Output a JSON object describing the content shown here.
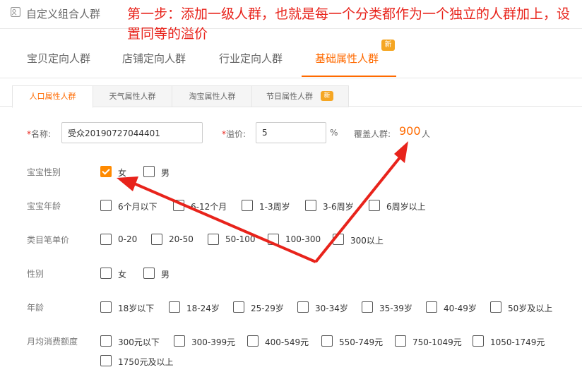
{
  "header": {
    "title": "自定义组合人群",
    "icon": "audience-edit-icon"
  },
  "annotation": "第一步：添加一级人群，也就是每一个分类都作为一个独立的人群加上，设置同等的溢价",
  "main_tabs": [
    {
      "label": "宝贝定向人群"
    },
    {
      "label": "店铺定向人群"
    },
    {
      "label": "行业定向人群"
    },
    {
      "label": "基础属性人群",
      "badge": "新"
    }
  ],
  "sub_tabs": [
    {
      "label": "人口属性人群"
    },
    {
      "label": "天气属性人群"
    },
    {
      "label": "淘宝属性人群"
    },
    {
      "label": "节日属性人群",
      "badge": "新"
    }
  ],
  "form": {
    "required_mark": "*",
    "name_label": "名称:",
    "name_value": "受众20190727044401",
    "premium_label": "溢价:",
    "premium_value": "5",
    "premium_unit": "%",
    "cover_label": "覆盖人群:",
    "cover_value": "900",
    "cover_unit": "人"
  },
  "rows": [
    {
      "label": "宝宝性别",
      "options": [
        {
          "text": "女",
          "checked": true
        },
        {
          "text": "男",
          "checked": false
        }
      ]
    },
    {
      "label": "宝宝年龄",
      "options": [
        {
          "text": "6个月以下"
        },
        {
          "text": "6-12个月"
        },
        {
          "text": "1-3周岁"
        },
        {
          "text": "3-6周岁"
        },
        {
          "text": "6周岁以上"
        }
      ]
    },
    {
      "label": "类目笔单价",
      "options": [
        {
          "text": "0-20"
        },
        {
          "text": "20-50"
        },
        {
          "text": "50-100"
        },
        {
          "text": "100-300"
        },
        {
          "text": "300以上"
        }
      ]
    },
    {
      "label": "性别",
      "options": [
        {
          "text": "女"
        },
        {
          "text": "男"
        }
      ]
    },
    {
      "label": "年龄",
      "options": [
        {
          "text": "18岁以下"
        },
        {
          "text": "18-24岁"
        },
        {
          "text": "25-29岁"
        },
        {
          "text": "30-34岁"
        },
        {
          "text": "35-39岁"
        },
        {
          "text": "40-49岁"
        },
        {
          "text": "50岁及以上"
        }
      ]
    },
    {
      "label": "月均消费额度",
      "options": [
        {
          "text": "300元以下"
        },
        {
          "text": "300-399元"
        },
        {
          "text": "400-549元"
        },
        {
          "text": "550-749元"
        },
        {
          "text": "750-1049元"
        },
        {
          "text": "1050-1749元"
        },
        {
          "text": "1750元及以上"
        }
      ]
    }
  ],
  "colors": {
    "accent": "#ff6a00",
    "annotation": "#e8231b",
    "badge": "#f5a623"
  }
}
